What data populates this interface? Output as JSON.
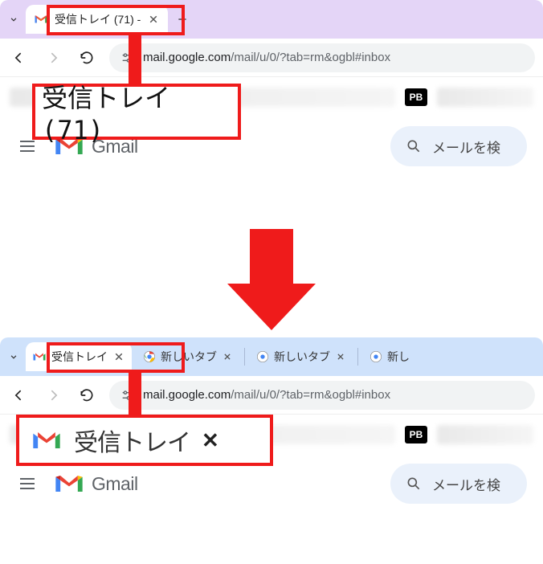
{
  "colors": {
    "accent": "#ef1b1b",
    "tabstrip_top": "#e4d5f7",
    "tabstrip_bottom": "#cfe2fb",
    "search_bg": "#eaf1fb"
  },
  "top": {
    "tab": {
      "title": "受信トレイ (71) -"
    },
    "url": {
      "host": "mail.google.com",
      "path": "/mail/u/0/?tab=rm&ogbl#inbox"
    },
    "pb_badge": "PB",
    "gmail_word": "Gmail",
    "search_placeholder": "メールを検",
    "zoom_label": "受信トレイ (71)"
  },
  "bottom": {
    "tab_active": {
      "title": "受信トレイ"
    },
    "bg_tabs": [
      {
        "title": "新しいタブ"
      },
      {
        "title": "新しいタブ"
      },
      {
        "title": "新し"
      }
    ],
    "url": {
      "host": "mail.google.com",
      "path": "/mail/u/0/?tab=rm&ogbl#inbox"
    },
    "pb_badge": "PB",
    "gmail_word": "Gmail",
    "search_placeholder": "メールを検",
    "zoom_label": "受信トレイ"
  }
}
